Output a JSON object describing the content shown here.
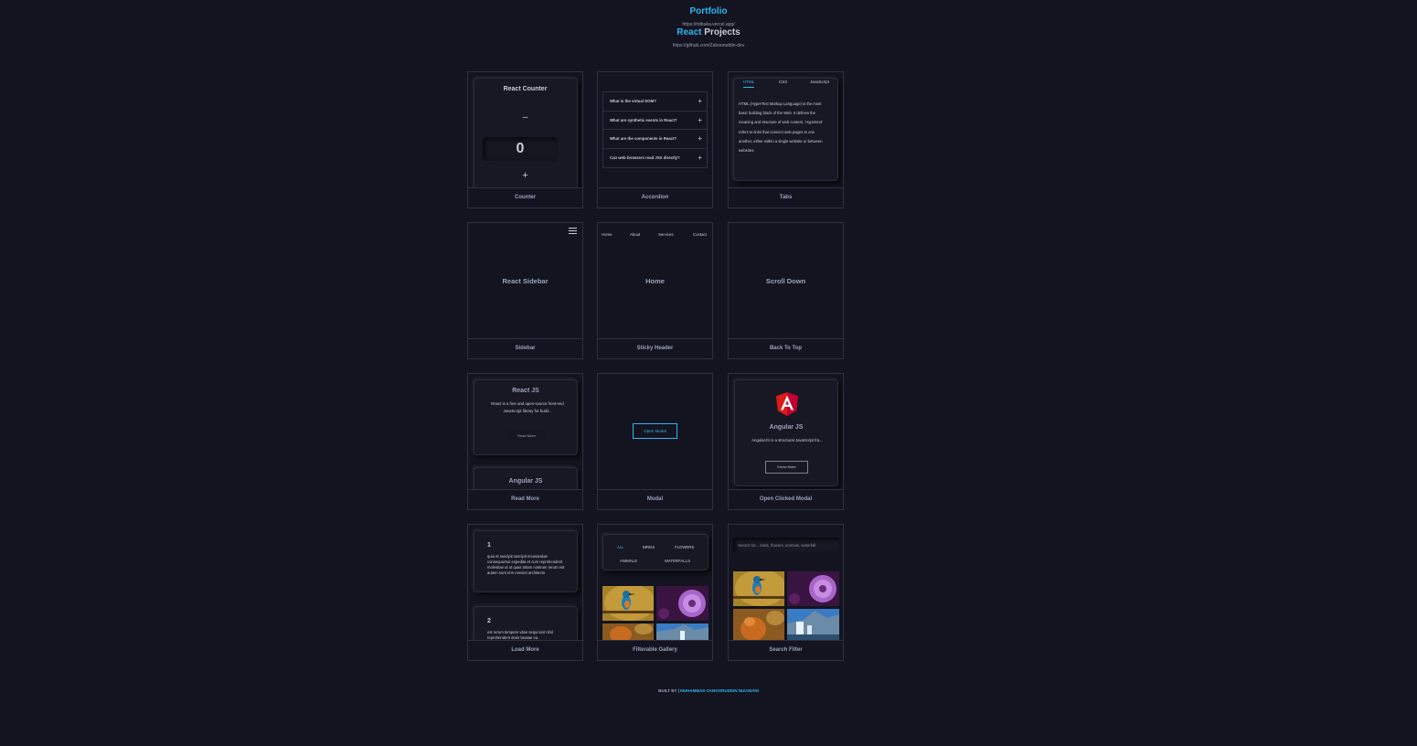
{
  "header": {
    "title": "Portfolio",
    "portfolio_url": "https://mtbuka.vercel.app/",
    "subtitle_accent": "React",
    "subtitle_rest": " Projects",
    "github_url": "https://github.com/Zahooruddin-dev"
  },
  "cards": {
    "counter": {
      "caption": "Counter",
      "title": "React Counter",
      "minus": "–",
      "value": "0",
      "plus": "+"
    },
    "accordion": {
      "caption": "Accordion",
      "items": [
        "What is the virtual DOM?",
        "What are synthetic events in React?",
        "What are the components in React?",
        "Can web browsers read JSX directly?"
      ],
      "plus": "+"
    },
    "tabs": {
      "caption": "Tabs",
      "tabs": [
        "HTML",
        "CSS",
        "JavaScript"
      ],
      "body": "HTML (HyperText Markup Language) is the most basic building block of the Web. It defines the meaning and structure of web content. 'Hypertext' refers to links that connect web pages to one another, either within a single website or between websites."
    },
    "sidebar": {
      "caption": "Sidebar",
      "text": "React Sidebar"
    },
    "sticky_header": {
      "caption": "Sticky Header",
      "nav": [
        "Home",
        "About",
        "Services",
        "Contact"
      ],
      "text": "Home"
    },
    "back_to_top": {
      "caption": "Back To Top",
      "text": "Scroll Down"
    },
    "read_more": {
      "caption": "Read More",
      "title": "React JS",
      "desc": "React is a free and open-source front-end JavaScript library for build...",
      "button": "Read More",
      "title2": "Angular JS"
    },
    "modal": {
      "caption": "Modal",
      "button": "Open Modal"
    },
    "clicked_modal": {
      "caption": "Open Clicked Modal",
      "title": "Angular JS",
      "desc": "AngularJS is a structural JavaScript fra...",
      "button": "Know More"
    },
    "load_more": {
      "caption": "Load More",
      "num1": "1",
      "text1": "quia et suscipit suscipit recusandae consequuntur expedita et cum reprehenderit molestiae ut ut quas totam nostrum rerum est autem sunt rem eveniet architecto",
      "num2": "2",
      "text2": "est rerum tempore vitae sequi sint nihil reprehenderit dolor beatae ea"
    },
    "gallery": {
      "caption": "Filterable Gallery",
      "tabs": [
        "ALL",
        "BIRDS",
        "FLOWERS",
        "ANIMALS",
        "WATERFALLS"
      ]
    },
    "search_filter": {
      "caption": "Search Filter",
      "placeholder": "Search for... birds, flowers, animals, waterfall"
    }
  },
  "footer": {
    "prefix": "BUILT BY | ",
    "name": "MUHAMMAD ZAHOORUDDIN NIZAMANI"
  },
  "colors": {
    "background": "#13141f",
    "accent": "#2fb6f2",
    "border": "#2d3040",
    "text": "#c9cdd8",
    "angular_red": "#dd1b16"
  }
}
